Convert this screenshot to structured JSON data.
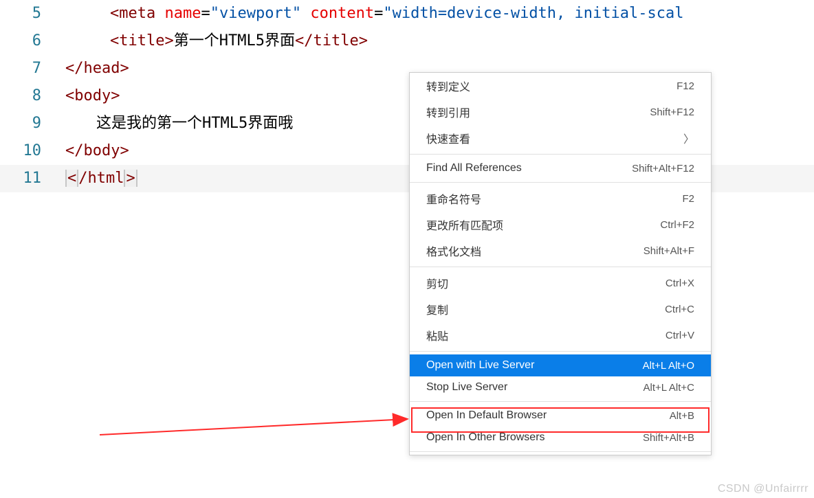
{
  "gutter": {
    "start": 5,
    "end": 11
  },
  "code": {
    "line5": {
      "tag": "meta",
      "attr1_name": "name",
      "attr1_value": "\"viewport\"",
      "attr2_name": "content",
      "attr2_value": "\"width=device-width, initial-scal"
    },
    "line6": {
      "open_tag": "title",
      "text": "第一个HTML5界面",
      "close_tag": "title"
    },
    "line7": {
      "close_tag": "head"
    },
    "line8": {
      "open_tag": "body"
    },
    "line9": {
      "text": "这是我的第一个HTML5界面哦"
    },
    "line10": {
      "close_tag": "body"
    },
    "line11": {
      "close_tag": "html"
    }
  },
  "menu": {
    "items": [
      {
        "label": "转到定义",
        "shortcut": "F12"
      },
      {
        "label": "转到引用",
        "shortcut": "Shift+F12"
      },
      {
        "label": "快速查看",
        "shortcut": "",
        "submenu": true
      }
    ],
    "group2": [
      {
        "label": "Find All References",
        "shortcut": "Shift+Alt+F12"
      }
    ],
    "group3": [
      {
        "label": "重命名符号",
        "shortcut": "F2"
      },
      {
        "label": "更改所有匹配项",
        "shortcut": "Ctrl+F2"
      },
      {
        "label": "格式化文档",
        "shortcut": "Shift+Alt+F"
      }
    ],
    "group4": [
      {
        "label": "剪切",
        "shortcut": "Ctrl+X"
      },
      {
        "label": "复制",
        "shortcut": "Ctrl+C"
      },
      {
        "label": "粘贴",
        "shortcut": "Ctrl+V"
      }
    ],
    "group5": [
      {
        "label": "Open with Live Server",
        "shortcut": "Alt+L Alt+O",
        "selected": true
      },
      {
        "label": "Stop Live Server",
        "shortcut": "Alt+L Alt+C"
      }
    ],
    "group6": [
      {
        "label": "Open In Default Browser",
        "shortcut": "Alt+B"
      },
      {
        "label": "Open In Other Browsers",
        "shortcut": "Shift+Alt+B"
      }
    ]
  },
  "watermark": "CSDN @Unfairrrr",
  "chevron": "〉"
}
